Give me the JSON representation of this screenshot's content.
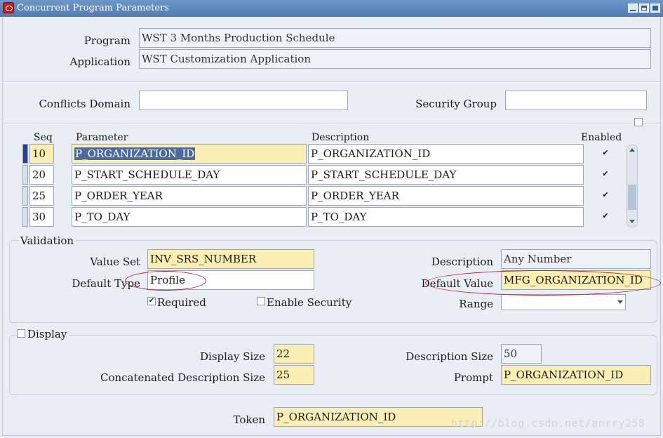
{
  "window": {
    "title": "Concurrent Program Parameters"
  },
  "header": {
    "program_label": "Program",
    "program_value": "WST 3 Months Production Schedule",
    "application_label": "Application",
    "application_value": "WST Customization Application",
    "conflicts_domain_label": "Conflicts Domain",
    "conflicts_domain_value": "",
    "security_group_label": "Security Group",
    "security_group_value": ""
  },
  "table": {
    "headers": {
      "seq": "Seq",
      "parameter": "Parameter",
      "description": "Description",
      "enabled": "Enabled"
    },
    "rows": [
      {
        "seq": "10",
        "parameter": "P_ORGANIZATION_ID",
        "description": "P_ORGANIZATION_ID",
        "enabled": "✔"
      },
      {
        "seq": "20",
        "parameter": "P_START_SCHEDULE_DAY",
        "description": "P_START_SCHEDULE_DAY",
        "enabled": "✔"
      },
      {
        "seq": "25",
        "parameter": "P_ORDER_YEAR",
        "description": "P_ORDER_YEAR",
        "enabled": "✔"
      },
      {
        "seq": "30",
        "parameter": "P_TO_DAY",
        "description": "P_TO_DAY",
        "enabled": "✔"
      }
    ]
  },
  "validation": {
    "title": "Validation",
    "value_set_label": "Value Set",
    "value_set_value": "INV_SRS_NUMBER",
    "default_type_label": "Default Type",
    "default_type_value": "Profile",
    "required_label": "Required",
    "required_mark": "✔",
    "enable_security_label": "Enable Security",
    "description_label": "Description",
    "description_value": "Any Number",
    "default_value_label": "Default Value",
    "default_value_value": "MFG_ORGANIZATION_ID",
    "range_label": "Range",
    "range_value": ""
  },
  "display": {
    "title": "Display",
    "display_size_label": "Display Size",
    "display_size_value": "22",
    "concat_desc_size_label": "Concatenated Description Size",
    "concat_desc_size_value": "25",
    "description_size_label": "Description Size",
    "description_size_value": "50",
    "prompt_label": "Prompt",
    "prompt_value": "P_ORGANIZATION_ID"
  },
  "token": {
    "label": "Token",
    "value": "P_ORGANIZATION_ID"
  },
  "watermark": "http://blog.csdn.net/anrry258",
  "colors": {
    "required_field": "#fcefb4",
    "selection": "#c9ddf2",
    "annotation": "#c51e2b",
    "titlebar": "#5a86bd"
  }
}
